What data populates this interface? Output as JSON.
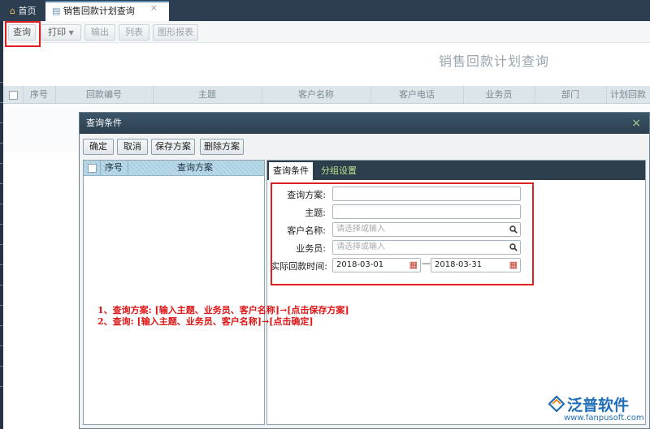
{
  "tabs": {
    "home": "首页",
    "active": "销售回款计划查询",
    "close": "×"
  },
  "toolbar": {
    "query": "查询",
    "print": "打印",
    "export": "输出",
    "columns": "列表",
    "chart_report": "图形报表"
  },
  "page_title": "销售回款计划查询",
  "grid": {
    "columns": [
      "序号",
      "回款编号",
      "主题",
      "客户名称",
      "客户电话",
      "业务员",
      "部门",
      "计划回款"
    ]
  },
  "dialog": {
    "title": "查询条件",
    "close": "×",
    "buttons": {
      "confirm": "确定",
      "cancel": "取消",
      "save_scheme": "保存方案",
      "delete_scheme": "删除方案"
    },
    "scheme_list": {
      "col_index": "序号",
      "col_scheme": "查询方案"
    },
    "tabs": {
      "conditions": "查询条件",
      "group": "分组设置"
    },
    "form": {
      "scheme_label": "查询方案:",
      "subject_label": "主题:",
      "customer_label": "客户名称:",
      "customer_placeholder": "请选择或输入",
      "salesman_label": "业务员:",
      "salesman_placeholder": "请选择或输入",
      "date_label": "实际回款时间:",
      "date_from": "2018-03-01",
      "date_to": "2018-03-31",
      "date_sep": "—"
    }
  },
  "annotations": {
    "line1": "1、查询方案: [输入主题、业务员、客户名称]→[点击保存方案]",
    "line2": "2、查询: [输入主题、业务员、客户名称]→[点击确定]"
  },
  "logo": {
    "name": "泛普软件",
    "url": "www.fanpusoft.com"
  },
  "colors": {
    "highlight": "#e02020",
    "dialog_header": "#2b4050",
    "logo_blue": "#1e6fb8"
  }
}
